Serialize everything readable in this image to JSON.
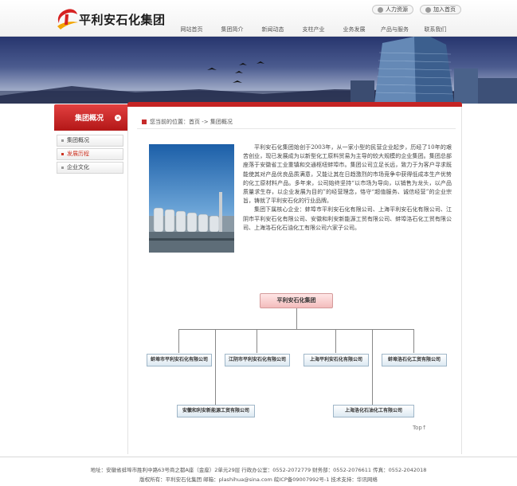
{
  "header": {
    "brand": "平利安石化集团",
    "top_links": [
      {
        "label": "人力资源"
      },
      {
        "label": "加入首页"
      }
    ],
    "nav": [
      "网站首页",
      "集团简介",
      "新闻动态",
      "支柱产业",
      "业务发展",
      "产品与服务",
      "联系我们"
    ]
  },
  "sidebar": {
    "title": "集团概况",
    "items": [
      {
        "label": "集团概况"
      },
      {
        "label": "发展历程"
      },
      {
        "label": "企业文化"
      }
    ]
  },
  "breadcrumb": {
    "text": "您当前的位置：首页 -> 集团概况"
  },
  "content": {
    "paragraph1": "平利安石化集团始创于2003年，从一家小型的民营企业起步，历经了10年的艰苦创业，现已发展成为以新型化工原料贸易为主导的较大规模的企业集团。集团总部座落于安徽省工业重镇和交通枢纽蚌埠市。集团公司立足长远，致力于为客户寻求既能使其对产品优良品质满意，又能让其在日趋激烈的市场竞争中获得低成本生产优势的化工原材料产品。多年来，公司始终坚持“以市场为导向，以销售为龙头，以产品质量求生存，以企业发展为目的”的经营理念，恪守“超值服务、诚信经营”的企业宗旨，铸就了平利安石化的行业品牌。",
    "paragraph2": "集团下属核心企业：蚌埠市平利安石化有限公司、上海平利安石化有限公司、江阴市平利安石化有限公司、安徽和利安新能源工贸有限公司、蚌埠洛石化工贸有限公司、上海洛石化石油化工有限公司六家子公司。"
  },
  "org_chart": {
    "root": "平利安石化集团",
    "row1": [
      "蚌埠市平利安石化有限公司",
      "江阴市平利安石化有限公司",
      "上海平利安石化有限公司",
      "蚌埠洛石化工贸有限公司"
    ],
    "row2": [
      "安徽和利安新能源工贸有限公司",
      "上海洛化石油化工有限公司"
    ]
  },
  "back_to_top": "Top↑",
  "footer": {
    "line1": "地址：安徽省蚌埠市胜利中路63号商之都A座（金座）2单元29层   行政办公室：0552-2072779 财务部：0552-2076611 传真：0552-2042018",
    "line2": "版权所有：平利安石化集团   邮箱：plashihua@sina.com 皖ICP备09007992号-1   技术支持：华讯网络"
  }
}
